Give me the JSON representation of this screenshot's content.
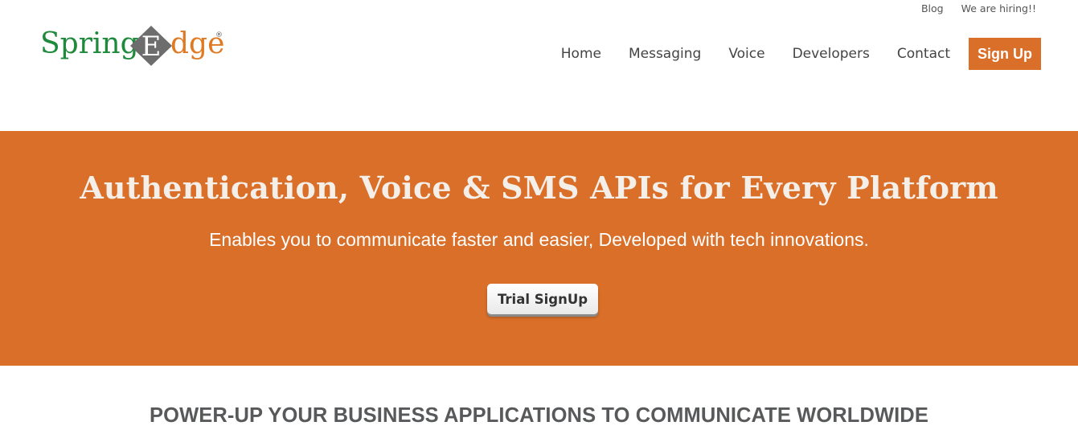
{
  "topbar": {
    "links": [
      "Blog",
      "We are hiring!!"
    ]
  },
  "logo": {
    "text_left": "Spring",
    "text_e": "E",
    "text_right": "dge",
    "reg_mark": "®",
    "colors": {
      "green": "#1f8a3c",
      "orange": "#e07a22",
      "diamond": "#6d6d6d"
    }
  },
  "nav": {
    "items": [
      "Home",
      "Messaging",
      "Voice",
      "Developers",
      "Contact"
    ],
    "signup_label": "Sign Up"
  },
  "hero": {
    "title": "Authentication, Voice & SMS APIs for Every Platform",
    "subtitle": "Enables you to communicate faster and easier, Developed with tech innovations.",
    "cta_label": "Trial SignUp",
    "background": "#d96f29"
  },
  "section": {
    "title": "POWER-UP YOUR BUSINESS APPLICATIONS TO COMMUNICATE WORLDWIDE"
  }
}
